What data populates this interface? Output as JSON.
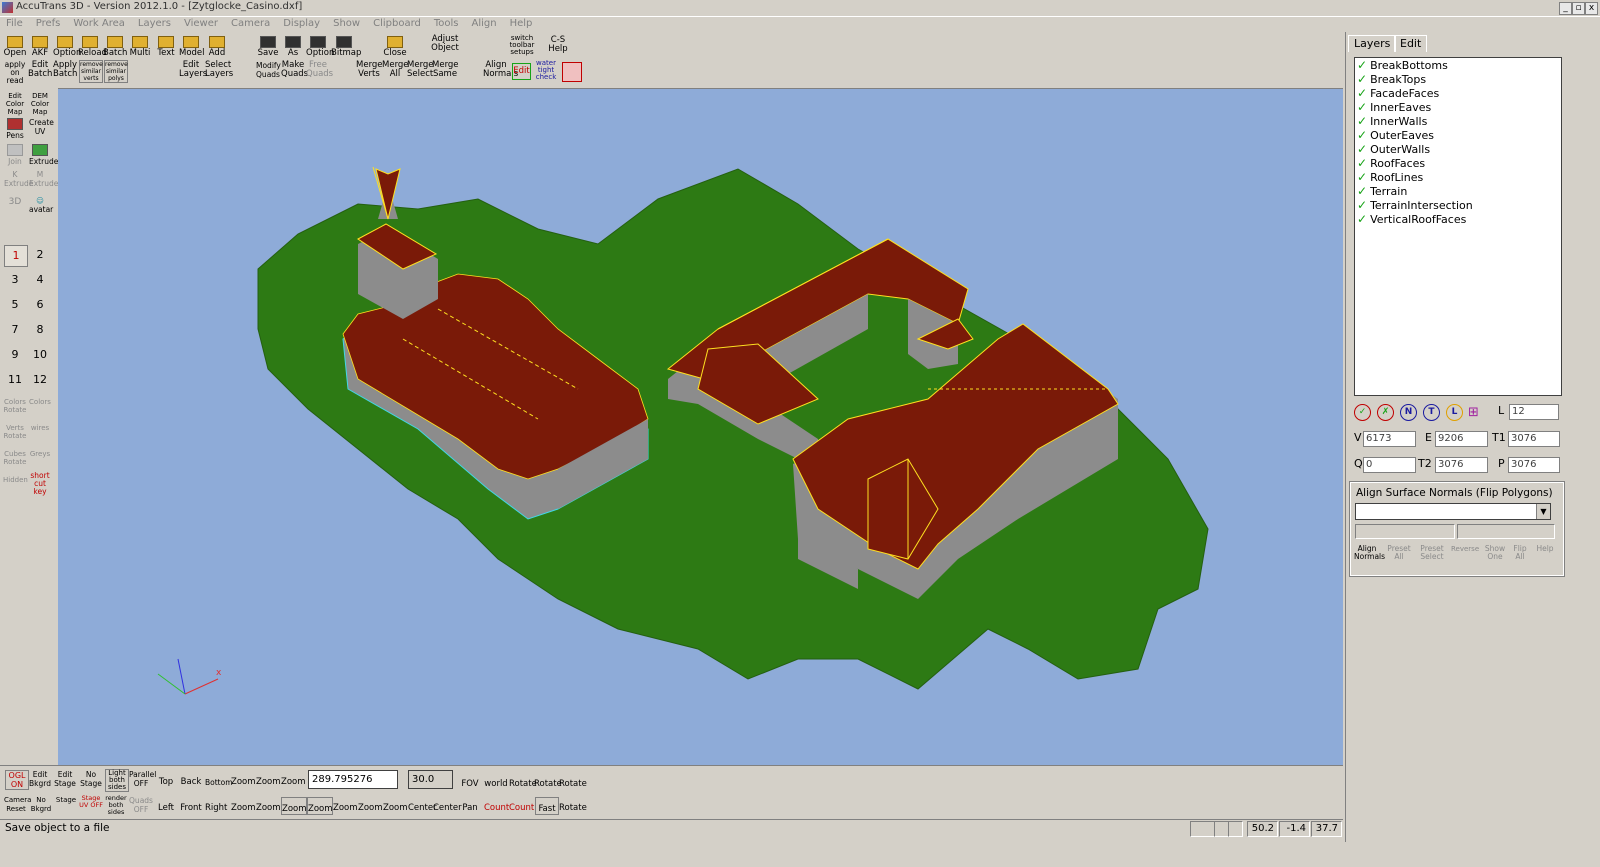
{
  "window": {
    "title": "AccuTrans 3D - Version 2012.1.0 - [Zytglocke_Casino.dxf]"
  },
  "menu": [
    "File",
    "Prefs",
    "Work Area",
    "Layers",
    "Viewer",
    "Camera",
    "Display",
    "Show",
    "Clipboard",
    "Tools",
    "Align",
    "Help"
  ],
  "toolbar_top": {
    "row1": [
      "Open",
      "AKF",
      "Option",
      "Reload",
      "Batch",
      "Multi",
      "Text",
      "Model",
      "Add",
      "Save",
      "As",
      "Option",
      "Bitmap",
      "Close",
      "Adjust Object",
      "switch toolbar setups",
      "C-S Help"
    ],
    "row2": [
      "apply on read",
      "Edit Batch",
      "Apply Batch",
      "remove similar verts",
      "remove similar polys",
      "Edit Layers",
      "Select Layers",
      "Modify Quads",
      "Make Quads",
      "Free Quads",
      "Merge Verts",
      "Merge All",
      "Merge Select",
      "Merge Same",
      "Align Normals",
      "Edit",
      "water tight check"
    ]
  },
  "left_panel": {
    "tools": [
      "Edit Color Map",
      "DEM Color Map",
      "Pens",
      "Create UV",
      "Join",
      "Extrude",
      "K Extrude",
      "M Extrude",
      "3D",
      "avatar"
    ],
    "numbers": [
      "1",
      "2",
      "3",
      "4",
      "5",
      "6",
      "7",
      "8",
      "9",
      "10",
      "11",
      "12"
    ],
    "lower": [
      "Colors Rotate",
      "Colors",
      "Verts Rotate",
      "wires",
      "Cubes Rotate",
      "Greys",
      "Hidden",
      "short cut key"
    ]
  },
  "layers_panel": {
    "tabs": [
      "Layers",
      "Edit"
    ],
    "layers": [
      "BreakBottoms",
      "BreakTops",
      "FacadeFaces",
      "InnerEaves",
      "InnerWalls",
      "OuterEaves",
      "OuterWalls",
      "RoofFaces",
      "RoofLines",
      "Terrain",
      "TerrainIntersection",
      "VerticalRoofFaces"
    ],
    "circle_buttons": [
      "N",
      "T",
      "L"
    ],
    "L_label": "L",
    "L_value": "12",
    "V_label": "V",
    "V_value": "6173",
    "E_label": "E",
    "E_value": "9206",
    "T1_label": "T1",
    "T1_value": "3076",
    "Q_label": "Q",
    "Q_value": "0",
    "T2_label": "T2",
    "T2_value": "3076",
    "P_label": "P",
    "P_value": "3076",
    "align_title": "Align Surface Normals (Flip Polygons)",
    "align_buttons": [
      "Align Normals",
      "Preset All",
      "Preset Select",
      "Reverse",
      "Show One",
      "Flip All",
      "Help"
    ]
  },
  "bottom_toolbar": {
    "row1": [
      "OGL ON",
      "Edit Bkgrd",
      "Edit Stage",
      "No Stage",
      "Light both sides",
      "Parallel OFF",
      "Top",
      "Back",
      "Bottom",
      "Zoom",
      "Zoom",
      "Zoom"
    ],
    "row2": [
      "Camera Reset",
      "No Bkgrd",
      "Stage",
      "Stage UV OFF",
      "render both sides",
      "Quads OFF",
      "Left",
      "Front",
      "Right",
      "Zoom",
      "Zoom",
      "Zoom",
      "Zoom",
      "Zoom",
      "Zoom",
      "Zoom"
    ],
    "zoom_value": "289.795276",
    "fov_value": "30.0",
    "right_labels_r1": [
      "FOV",
      "world",
      "Rotate",
      "Rotate",
      "Rotate"
    ],
    "right_labels_r2": [
      "Center",
      "Center",
      "Pan",
      "Count",
      "Count",
      "Fast",
      "Rotate"
    ]
  },
  "status": {
    "message": "Save object to a file",
    "x": "50.2",
    "y": "-1.4",
    "z": "37.7"
  },
  "colors": {
    "viewport": "#8eabd8",
    "terrain": "#2d7a14",
    "roof": "#7a1a08",
    "walls": "#8a8a8a",
    "edges_cyan": "#40d8e8",
    "edges_yellow": "#ffe020",
    "check": "#17a317"
  }
}
